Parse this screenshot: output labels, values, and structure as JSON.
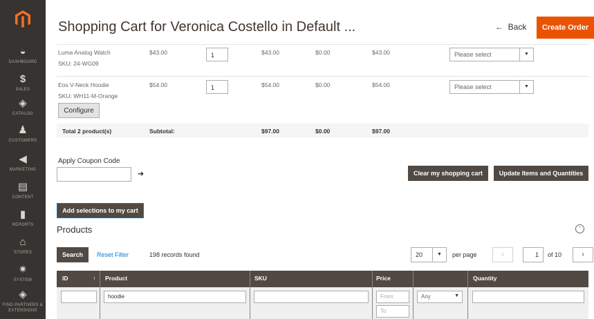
{
  "sidebar": {
    "items": [
      {
        "label": "DASHBOARD",
        "icon": "dashboard-icon",
        "glyph": "◒"
      },
      {
        "label": "SALES",
        "icon": "dollar-icon",
        "glyph": "$"
      },
      {
        "label": "CATALOG",
        "icon": "cube-icon",
        "glyph": "◈"
      },
      {
        "label": "CUSTOMERS",
        "icon": "person-icon",
        "glyph": "♟"
      },
      {
        "label": "MARKETING",
        "icon": "megaphone-icon",
        "glyph": "◀"
      },
      {
        "label": "CONTENT",
        "icon": "layout-icon",
        "glyph": "▤"
      },
      {
        "label": "REPORTS",
        "icon": "bar-chart-icon",
        "glyph": "▮"
      },
      {
        "label": "STORES",
        "icon": "store-icon",
        "glyph": "⌂"
      },
      {
        "label": "SYSTEM",
        "icon": "gear-icon",
        "glyph": "✷"
      },
      {
        "label": "FIND PARTNERS & EXTENSIONS",
        "icon": "puzzle-icon",
        "glyph": "◈"
      }
    ]
  },
  "header": {
    "title": "Shopping Cart for Veronica Costello in Default ...",
    "back_label": "Back",
    "create_order_label": "Create Order"
  },
  "cart": {
    "items": [
      {
        "name": "Luma Analog Watch",
        "sku": "SKU: 24-WG09",
        "price": "$43.00",
        "qty": "1",
        "subtotal": "$43.00",
        "discount": "$0.00",
        "row_total": "$43.00",
        "action": "Please select"
      },
      {
        "name": "Eos V-Neck Hoodie",
        "sku": "SKU: WH11-M-Orange",
        "price": "$54.00",
        "qty": "1",
        "subtotal": "$54.00",
        "discount": "$0.00",
        "row_total": "$54.00",
        "action": "Please select"
      }
    ],
    "configure_label": "Configure",
    "totals": {
      "label": "Total 2 product(s)",
      "subtotal_label": "Subtotal:",
      "subtotal": "$97.00",
      "discount": "$0.00",
      "row_total": "$97.00"
    }
  },
  "coupon": {
    "label": "Apply Coupon Code",
    "value": ""
  },
  "actions": {
    "clear_cart": "Clear my shopping cart",
    "update_items": "Update Items and Quantities",
    "add_selections": "Add selections to my cart"
  },
  "products": {
    "title": "Products",
    "search_label": "Search",
    "reset_label": "Reset Filter",
    "records": "198 records found",
    "per_page": "20",
    "per_page_label": "per page",
    "page": "1",
    "page_of": "of 10",
    "columns": {
      "id": "ID",
      "product": "Product",
      "sku": "SKU",
      "price": "Price",
      "quantity": "Quantity"
    },
    "filters": {
      "product": "hoodie",
      "price_from": "From",
      "price_to": "To",
      "website": "Any"
    }
  },
  "colors": {
    "accent": "#eb5202",
    "sidebar": "#373330",
    "dark_button": "#514943",
    "link": "#007bdb"
  }
}
